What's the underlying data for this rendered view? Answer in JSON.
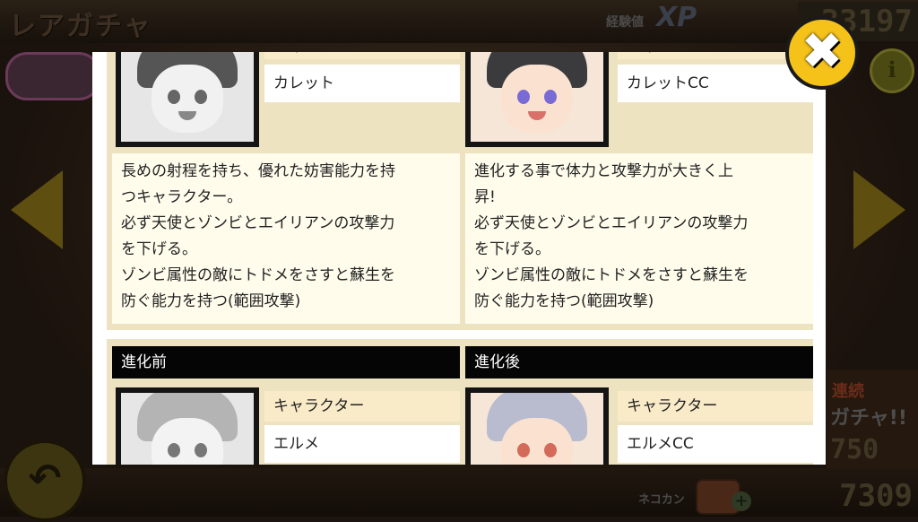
{
  "header": {
    "title": "レアガチャ",
    "xp_label": "経験値",
    "xp_icon": "XP",
    "xp_value": "33197"
  },
  "side": {
    "info_label": "i",
    "gacha_hint_1": "連続",
    "gacha_hint_2": "ガチャ!!",
    "gacha_cost": "750"
  },
  "footer": {
    "nekokan_label": "ネコカン",
    "nekokan_value": "7309"
  },
  "icons": {
    "close": "close-icon",
    "back": "back-arrow-icon",
    "prev": "chevron-left-icon",
    "next": "chevron-right-icon",
    "info": "info-icon",
    "can": "cat-food-can-icon",
    "plus": "plus-icon"
  },
  "colors": {
    "close_button": "#f5c21a",
    "section_bg": "#eee3c1",
    "label_bg": "#faebc8",
    "header_bar": "#050505"
  },
  "modal": {
    "pair1": {
      "before": {
        "label": "キャラクター",
        "name": "カレット",
        "desc": [
          "長めの射程を持ち、優れた妨害能力を持",
          "つキャラクター。",
          "必ず天使とゾンビとエイリアンの攻撃力",
          "を下げる。",
          "ゾンビ属性の敵にトドメをさすと蘇生を",
          "防ぐ能力を持つ(範囲攻撃)"
        ]
      },
      "after": {
        "label": "キャラクター",
        "name": "カレットCC",
        "desc": [
          "進化する事で体力と攻撃力が大きく上",
          "昇!",
          "必ず天使とゾンビとエイリアンの攻撃力",
          "を下げる。",
          "ゾンビ属性の敵にトドメをさすと蘇生を",
          "防ぐ能力を持つ(範囲攻撃)"
        ]
      }
    },
    "pair2": {
      "before": {
        "header": "進化前",
        "label": "キャラクター",
        "name": "エルメ"
      },
      "after": {
        "header": "進化後",
        "label": "キャラクター",
        "name": "エルメCC"
      }
    }
  }
}
